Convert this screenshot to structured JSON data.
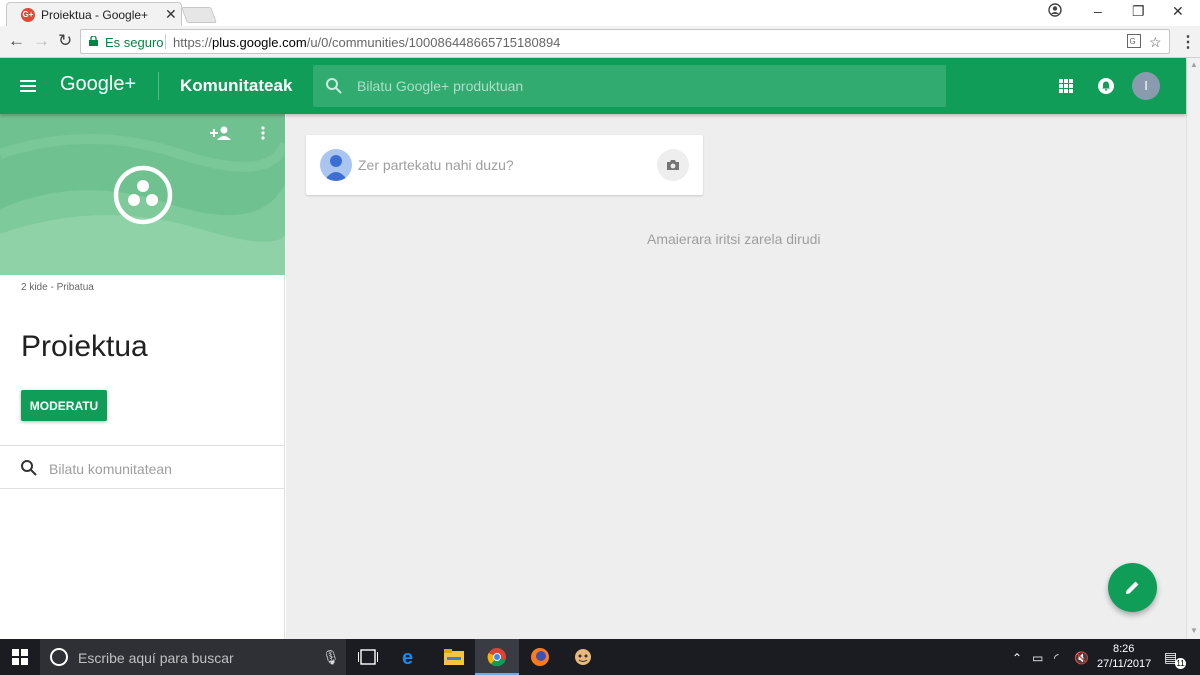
{
  "browser": {
    "tab_title": "Proiektua - Google+",
    "favicon_text": "G+",
    "secure_label": "Es seguro",
    "url_prefix": "https://",
    "url_host": "plus.google.com",
    "url_rest": "/u/0/communities/100086448665715180894"
  },
  "header": {
    "logo": "Google+",
    "title": "Komunitateak",
    "search_placeholder": "Bilatu Google+ produktuan",
    "avatar_letter": "I"
  },
  "community": {
    "meta": "2 kide - Pribatua",
    "name": "Proiektua",
    "moderate_label": "MODERATU",
    "search_placeholder": "Bilatu komunitatean"
  },
  "main": {
    "share_prompt": "Zer partekatu nahi duzu?",
    "end_message": "Amaierara iritsi zarela dirudi"
  },
  "taskbar": {
    "search_label": "Escribe aquí para buscar",
    "time": "8:26",
    "date": "27/11/2017",
    "notification_count": "11"
  },
  "colors": {
    "brand_green": "#0f9d58",
    "cover_green": "#6fc28f",
    "main_bg": "#eeeeee"
  }
}
